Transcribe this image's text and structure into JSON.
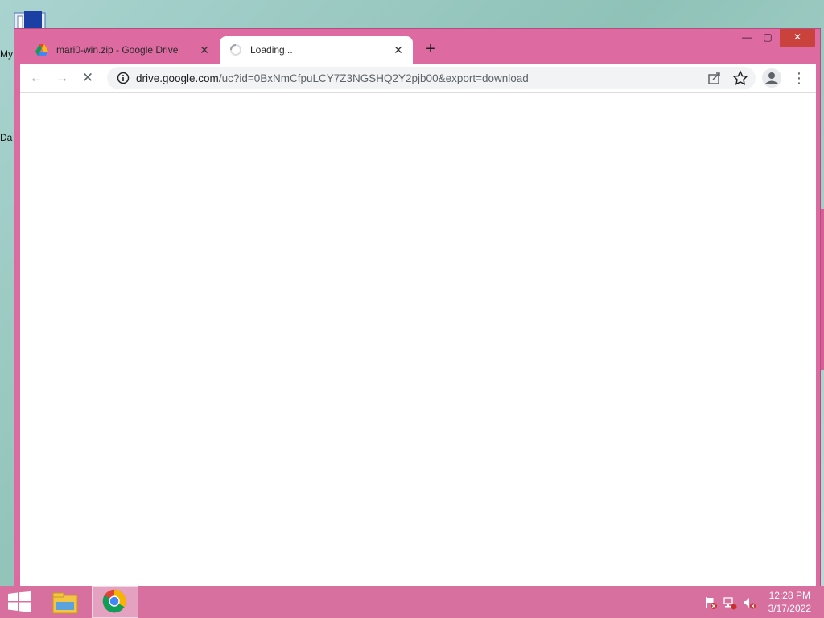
{
  "desktop": {
    "labels": [
      "My",
      "Da"
    ]
  },
  "browser": {
    "tabs": [
      {
        "title": "mari0-win.zip - Google Drive",
        "favicon": "google-drive-icon",
        "close": "✕",
        "active": false
      },
      {
        "title": "Loading...",
        "favicon": "loading-spinner-icon",
        "close": "✕",
        "active": true
      }
    ],
    "new_tab": "+",
    "window_controls": {
      "minimize": "—",
      "maximize": "▢",
      "close": "✕"
    },
    "toolbar": {
      "back": "←",
      "forward": "→",
      "stop": "✕",
      "url_host": "drive.google.com",
      "url_rest": "/uc?id=0BxNmCfpuLCY7Z3NGSHQ2Y2pjb00&export=download",
      "menu": "⋮"
    }
  },
  "taskbar": {
    "apps": [
      "file-explorer-icon",
      "chrome-icon"
    ],
    "tray_icons": [
      "action-center-flag-icon",
      "network-icon",
      "volume-muted-icon"
    ],
    "time": "12:28 PM",
    "date": "3/17/2022"
  },
  "colors": {
    "window_frame": "#dd6aa0",
    "taskbar": "#d7709f",
    "close_button": "#c9423b"
  }
}
